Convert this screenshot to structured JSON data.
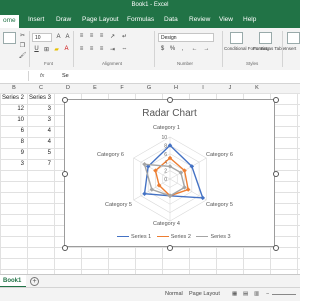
{
  "window": {
    "title": "Book1 - Excel"
  },
  "tabs": [
    "ome",
    "Insert",
    "Draw",
    "Page Layout",
    "Formulas",
    "Data",
    "Review",
    "View",
    "Help"
  ],
  "ribbon": {
    "font_size": "10",
    "number_format": "Design",
    "groups": [
      "Font",
      "Alignment",
      "Number",
      "Styles"
    ],
    "conditional_formatting": "Conditional Formatting",
    "format_as_table": "Format as Table",
    "insert": "Insert"
  },
  "formula_bar": {
    "fx": "fx",
    "value": "Se"
  },
  "columns": [
    "B",
    "C",
    "D",
    "E",
    "F",
    "G",
    "H",
    "I",
    "J",
    "K"
  ],
  "table": {
    "headers": [
      "Series 2",
      "Series 3"
    ],
    "rows": [
      [
        "12",
        "3"
      ],
      [
        "10",
        "3"
      ],
      [
        "6",
        "4"
      ],
      [
        "8",
        "4"
      ],
      [
        "9",
        "5"
      ],
      [
        "3",
        "7"
      ]
    ]
  },
  "sheet": {
    "tab_label": "Book1"
  },
  "status": {
    "normal": "Normal",
    "page_layout": "Page Layout"
  },
  "chart_data": {
    "type": "radar",
    "title": "Radar Chart",
    "categories": [
      "Category 1",
      "Category 6",
      "Category 5",
      "Category 4",
      "Category 5",
      "Category 6"
    ],
    "rlim": [
      0,
      10
    ],
    "ticks": [
      "0",
      "2",
      "4",
      "6",
      "8",
      "10"
    ],
    "series": [
      {
        "name": "Series 1",
        "color": "#4472c4",
        "values": [
          8,
          6,
          9,
          4,
          7,
          6
        ]
      },
      {
        "name": "Series 2",
        "color": "#ed7d31",
        "values": [
          5,
          4,
          5,
          4,
          3,
          4
        ]
      },
      {
        "name": "Series 3",
        "color": "#a5a5a5",
        "values": [
          3,
          3,
          4,
          4,
          5,
          7
        ]
      }
    ],
    "legend": "bottom"
  }
}
